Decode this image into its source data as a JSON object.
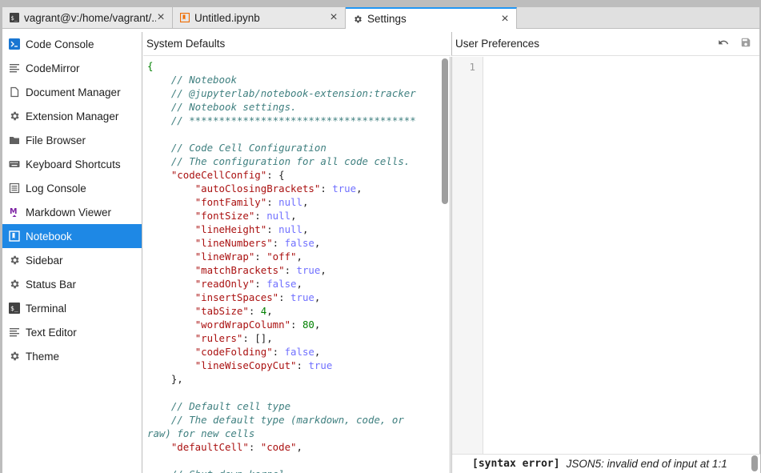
{
  "tabs": [
    {
      "label": "vagrant@v:/home/vagrant/...",
      "icon": "terminal-icon"
    },
    {
      "label": "Untitled.ipynb",
      "icon": "notebook-icon"
    },
    {
      "label": "Settings",
      "icon": "gear-icon"
    }
  ],
  "sidebar": {
    "items": [
      {
        "label": "Code Console",
        "icon": "console-icon"
      },
      {
        "label": "CodeMirror",
        "icon": "text-lines-icon"
      },
      {
        "label": "Document Manager",
        "icon": "file-icon"
      },
      {
        "label": "Extension Manager",
        "icon": "gear-icon"
      },
      {
        "label": "File Browser",
        "icon": "folder-icon"
      },
      {
        "label": "Keyboard Shortcuts",
        "icon": "keyboard-icon"
      },
      {
        "label": "Log Console",
        "icon": "list-icon"
      },
      {
        "label": "Markdown Viewer",
        "icon": "markdown-icon"
      },
      {
        "label": "Notebook",
        "icon": "notebook-icon",
        "active": true
      },
      {
        "label": "Sidebar",
        "icon": "gear-icon"
      },
      {
        "label": "Status Bar",
        "icon": "gear-icon"
      },
      {
        "label": "Terminal",
        "icon": "terminal-icon"
      },
      {
        "label": "Text Editor",
        "icon": "text-lines-icon"
      },
      {
        "label": "Theme",
        "icon": "gear-icon"
      }
    ]
  },
  "system_defaults": {
    "title": "System Defaults",
    "code_lines": [
      [
        [
          "c-brace",
          "{"
        ]
      ],
      [
        [
          "",
          "    "
        ],
        [
          "c-comment",
          "// Notebook"
        ]
      ],
      [
        [
          "",
          "    "
        ],
        [
          "c-comment",
          "// @jupyterlab/notebook-extension:tracker"
        ]
      ],
      [
        [
          "",
          "    "
        ],
        [
          "c-comment",
          "// Notebook settings."
        ]
      ],
      [
        [
          "",
          "    "
        ],
        [
          "c-comment",
          "// **************************************"
        ]
      ],
      [
        [
          "",
          ""
        ]
      ],
      [
        [
          "",
          "    "
        ],
        [
          "c-comment",
          "// Code Cell Configuration"
        ]
      ],
      [
        [
          "",
          "    "
        ],
        [
          "c-comment",
          "// The configuration for all code cells."
        ]
      ],
      [
        [
          "",
          "    "
        ],
        [
          "c-key",
          "\"codeCellConfig\""
        ],
        [
          "c-punc",
          ": {"
        ]
      ],
      [
        [
          "",
          "        "
        ],
        [
          "c-key",
          "\"autoClosingBrackets\""
        ],
        [
          "c-punc",
          ": "
        ],
        [
          "c-atom",
          "true"
        ],
        [
          "c-punc",
          ","
        ]
      ],
      [
        [
          "",
          "        "
        ],
        [
          "c-key",
          "\"fontFamily\""
        ],
        [
          "c-punc",
          ": "
        ],
        [
          "c-atom",
          "null"
        ],
        [
          "c-punc",
          ","
        ]
      ],
      [
        [
          "",
          "        "
        ],
        [
          "c-key",
          "\"fontSize\""
        ],
        [
          "c-punc",
          ": "
        ],
        [
          "c-atom",
          "null"
        ],
        [
          "c-punc",
          ","
        ]
      ],
      [
        [
          "",
          "        "
        ],
        [
          "c-key",
          "\"lineHeight\""
        ],
        [
          "c-punc",
          ": "
        ],
        [
          "c-atom",
          "null"
        ],
        [
          "c-punc",
          ","
        ]
      ],
      [
        [
          "",
          "        "
        ],
        [
          "c-key",
          "\"lineNumbers\""
        ],
        [
          "c-punc",
          ": "
        ],
        [
          "c-atom",
          "false"
        ],
        [
          "c-punc",
          ","
        ]
      ],
      [
        [
          "",
          "        "
        ],
        [
          "c-key",
          "\"lineWrap\""
        ],
        [
          "c-punc",
          ": "
        ],
        [
          "c-str",
          "\"off\""
        ],
        [
          "c-punc",
          ","
        ]
      ],
      [
        [
          "",
          "        "
        ],
        [
          "c-key",
          "\"matchBrackets\""
        ],
        [
          "c-punc",
          ": "
        ],
        [
          "c-atom",
          "true"
        ],
        [
          "c-punc",
          ","
        ]
      ],
      [
        [
          "",
          "        "
        ],
        [
          "c-key",
          "\"readOnly\""
        ],
        [
          "c-punc",
          ": "
        ],
        [
          "c-atom",
          "false"
        ],
        [
          "c-punc",
          ","
        ]
      ],
      [
        [
          "",
          "        "
        ],
        [
          "c-key",
          "\"insertSpaces\""
        ],
        [
          "c-punc",
          ": "
        ],
        [
          "c-atom",
          "true"
        ],
        [
          "c-punc",
          ","
        ]
      ],
      [
        [
          "",
          "        "
        ],
        [
          "c-key",
          "\"tabSize\""
        ],
        [
          "c-punc",
          ": "
        ],
        [
          "c-num",
          "4"
        ],
        [
          "c-punc",
          ","
        ]
      ],
      [
        [
          "",
          "        "
        ],
        [
          "c-key",
          "\"wordWrapColumn\""
        ],
        [
          "c-punc",
          ": "
        ],
        [
          "c-num",
          "80"
        ],
        [
          "c-punc",
          ","
        ]
      ],
      [
        [
          "",
          "        "
        ],
        [
          "c-key",
          "\"rulers\""
        ],
        [
          "c-punc",
          ": [],"
        ]
      ],
      [
        [
          "",
          "        "
        ],
        [
          "c-key",
          "\"codeFolding\""
        ],
        [
          "c-punc",
          ": "
        ],
        [
          "c-atom",
          "false"
        ],
        [
          "c-punc",
          ","
        ]
      ],
      [
        [
          "",
          "        "
        ],
        [
          "c-key",
          "\"lineWiseCopyCut\""
        ],
        [
          "c-punc",
          ": "
        ],
        [
          "c-atom",
          "true"
        ]
      ],
      [
        [
          "",
          "    "
        ],
        [
          "c-punc",
          "},"
        ]
      ],
      [
        [
          "",
          ""
        ]
      ],
      [
        [
          "",
          "    "
        ],
        [
          "c-comment",
          "// Default cell type"
        ]
      ],
      [
        [
          "",
          "    "
        ],
        [
          "c-comment",
          "// The default type (markdown, code, or"
        ]
      ],
      [
        [
          "c-comment",
          "raw) for new cells"
        ]
      ],
      [
        [
          "",
          "    "
        ],
        [
          "c-key",
          "\"defaultCell\""
        ],
        [
          "c-punc",
          ": "
        ],
        [
          "c-str",
          "\"code\""
        ],
        [
          "c-punc",
          ","
        ]
      ],
      [
        [
          "",
          ""
        ]
      ],
      [
        [
          "",
          "    "
        ],
        [
          "c-comment",
          "// Shut down kernel"
        ]
      ]
    ]
  },
  "user_preferences": {
    "title": "User Preferences",
    "line_number": "1",
    "status_tag": "[syntax error]",
    "status_message": "JSON5: invalid end of input at 1:1"
  }
}
